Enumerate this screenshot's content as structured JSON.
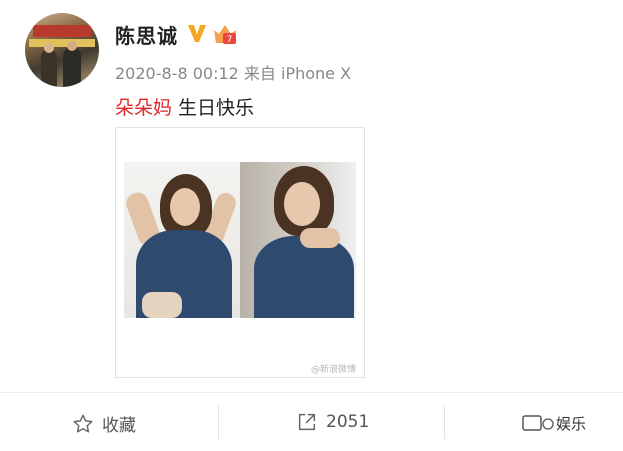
{
  "post": {
    "username": "陈思诚",
    "timestamp": "2020-8-8 00:12",
    "source": "来自 iPhone X",
    "mention": "朵朵妈",
    "text": " 生日快乐"
  },
  "badges": {
    "verified_icon": "v-verified-icon",
    "verified_color": "#f5a623",
    "member_icon": "crown-member-icon",
    "member_level": "7"
  },
  "image": {
    "watermark": "@新浪微博"
  },
  "actions": {
    "favorite_label": "收藏",
    "repost_count": "2051",
    "overlay_text": "娱乐"
  },
  "colors": {
    "mention": "#e2282b",
    "meta": "#888888"
  }
}
